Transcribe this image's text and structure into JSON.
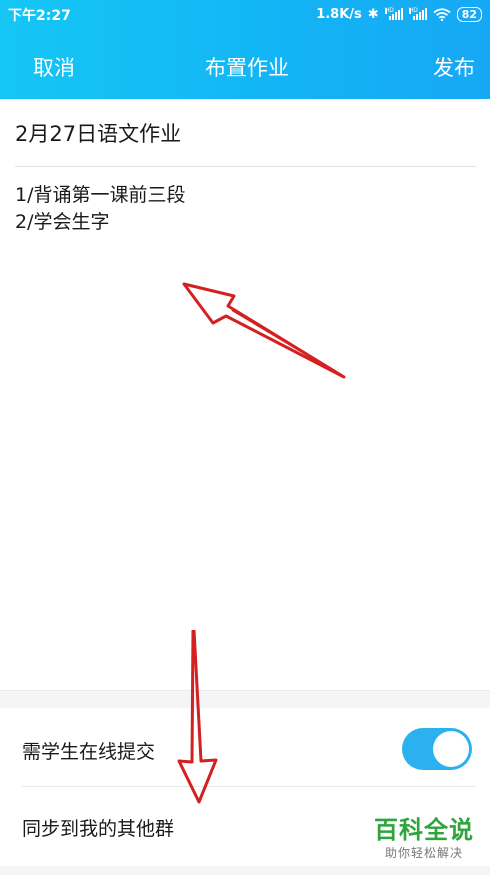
{
  "status_bar": {
    "time": "下午2:27",
    "network_speed": "1.8K/s",
    "bluetooth_icon": "bluetooth-icon",
    "signal_icons": [
      "signal-icon",
      "signal-icon"
    ],
    "wifi_icon": "wifi-icon",
    "battery": "82"
  },
  "nav": {
    "cancel_label": "取消",
    "title": "布置作业",
    "publish_label": "发布"
  },
  "form": {
    "title_value": "2月27日语文作业",
    "content_lines": [
      "1/背诵第一课前三段",
      "2/学会生字"
    ]
  },
  "settings": {
    "online_submit_label": "需学生在线提交",
    "online_submit_enabled": true,
    "sync_label": "同步到我的其他群"
  },
  "watermark": {
    "main": "百科全说",
    "sub": "助你轻松解决"
  },
  "colors": {
    "header_start": "#15c6f4",
    "header_end": "#16a8f4",
    "toggle_on": "#2ab1ee",
    "annotation_arrow": "#d42020",
    "watermark_green": "#2fa33c"
  }
}
